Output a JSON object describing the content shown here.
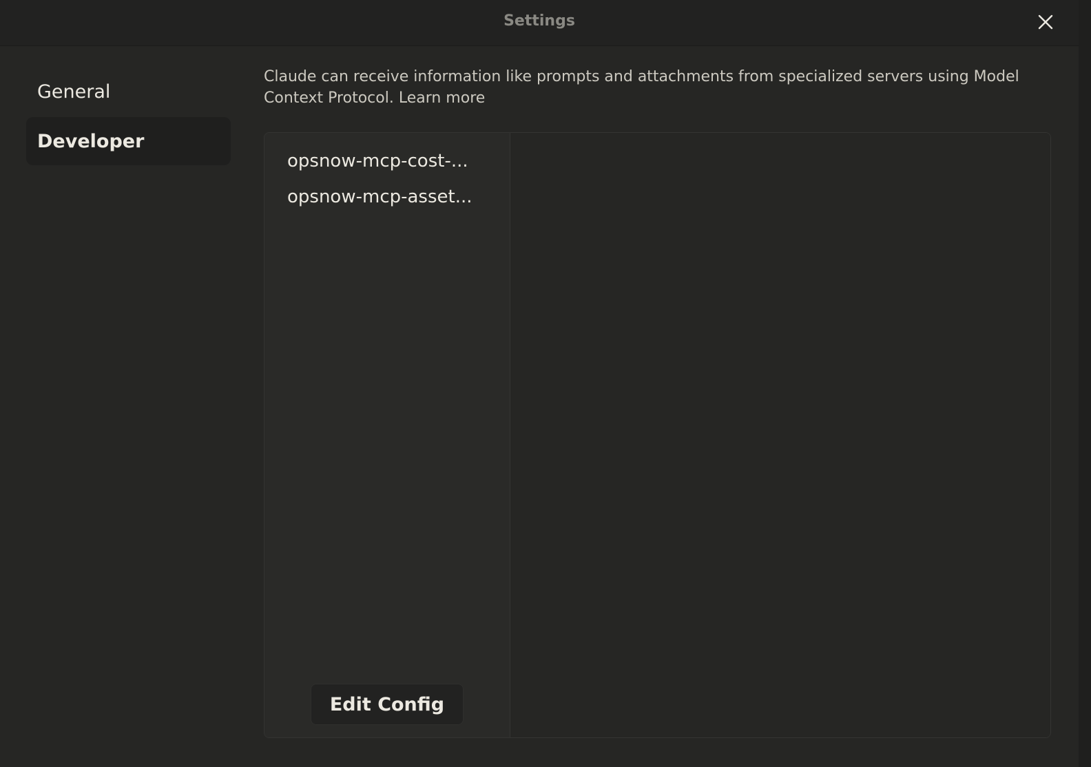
{
  "window": {
    "title": "Settings",
    "close_icon": "close-icon"
  },
  "sidebar": {
    "items": [
      {
        "label": "General",
        "active": false
      },
      {
        "label": "Developer",
        "active": true
      }
    ]
  },
  "developer": {
    "description": "Claude can receive information like prompts and attachments from specialized servers using Model Context Protocol.",
    "learn_more": "Learn more",
    "servers": [
      {
        "name": "opsnow-mcp-cost-..."
      },
      {
        "name": "opsnow-mcp-asset..."
      }
    ],
    "edit_config_label": "Edit Config"
  },
  "colors": {
    "background": "#262624",
    "titlebar": "#222221",
    "sidebar_active": "#1f1f1e",
    "text_primary": "#ece9e1",
    "text_muted": "#8a8983"
  }
}
